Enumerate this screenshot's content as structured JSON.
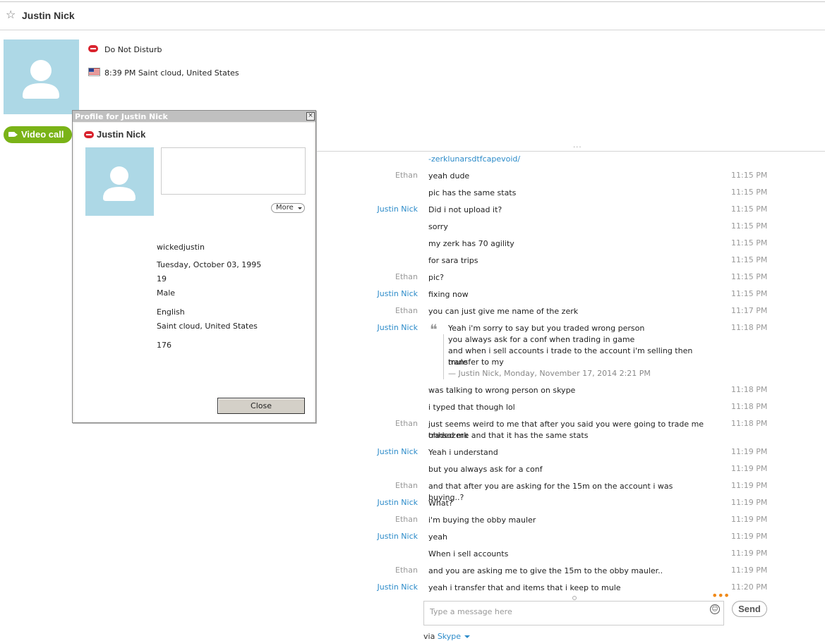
{
  "header": {
    "title": "Justin Nick",
    "favorite_icon": "star-outline-icon"
  },
  "contact": {
    "status": "Do Not Disturb",
    "local_time_location": "8:39 PM Saint cloud, United States",
    "video_call_label": "Video call"
  },
  "chat": {
    "messages": [
      {
        "sender": "",
        "text": "-zerklunarsdtfcapevoid/",
        "time": "",
        "is_link": true
      },
      {
        "sender": "Ethan",
        "text": "yeah dude",
        "time": "11:15 PM"
      },
      {
        "sender": "",
        "text": "pic has the same stats",
        "time": "11:15 PM"
      },
      {
        "sender": "Justin Nick",
        "text": "Did i not upload it?",
        "time": "11:15 PM"
      },
      {
        "sender": "",
        "text": "sorry",
        "time": "11:15 PM"
      },
      {
        "sender": "",
        "text": "my zerk has 70 agility",
        "time": "11:15 PM"
      },
      {
        "sender": "",
        "text": "for sara trips",
        "time": "11:15 PM"
      },
      {
        "sender": "Ethan",
        "text": "pic?",
        "time": "11:15 PM"
      },
      {
        "sender": "Justin Nick",
        "text": "fixing now",
        "time": "11:15 PM"
      },
      {
        "sender": "Ethan",
        "text": "you can just give me name of the zerk",
        "time": "11:17 PM"
      }
    ],
    "quote": {
      "sender": "Justin Nick",
      "time": "11:18 PM",
      "lines": [
        "Yeah i'm sorry to say but you traded wrong person",
        "you always ask for a conf when trading in game",
        "and when i sell accounts i trade to the account i'm selling then transfer to my",
        "mule"
      ],
      "attribution": "— Justin Nick, Monday, November 17, 2014 2:21 PM"
    },
    "messages_after": [
      {
        "sender": "",
        "text": "was talking to wrong person on skype",
        "time": "11:18 PM"
      },
      {
        "sender": "",
        "text": "i typed that though lol",
        "time": "11:18 PM"
      },
      {
        "sender": "Ethan",
        "text": "just seems weird to me that after you said you were going to trade me ohhsozerk",
        "text2": "traded me and that it has the same stats",
        "time": "11:18 PM"
      },
      {
        "sender": "Justin Nick",
        "text": "Yeah i understand",
        "time": "11:19 PM"
      },
      {
        "sender": "",
        "text": "but you always ask for a conf",
        "time": "11:19 PM"
      },
      {
        "sender": "Ethan",
        "text": "and that after you are asking for the 15m on the account i was buying..?",
        "time": "11:19 PM"
      },
      {
        "sender": "Justin Nick",
        "text": "What?",
        "time": "11:19 PM"
      },
      {
        "sender": "Ethan",
        "text": "i'm buying the obby mauler",
        "time": "11:19 PM"
      },
      {
        "sender": "Justin Nick",
        "text": "yeah",
        "time": "11:19 PM"
      },
      {
        "sender": "",
        "text": "When i sell accounts",
        "time": "11:19 PM"
      },
      {
        "sender": "Ethan",
        "text": "and you are asking me to give the 15m to the obby mauler..",
        "time": "11:19 PM"
      },
      {
        "sender": "Justin Nick",
        "text": "yeah i transfer that and items that i keep to mule",
        "time": "11:20 PM"
      }
    ]
  },
  "composer": {
    "placeholder": "Type a message here",
    "send_label": "Send",
    "via_label": "via",
    "via_service": "Skype"
  },
  "profile_dialog": {
    "window_title": "Profile for Justin Nick",
    "name": "Justin Nick",
    "more_label": "More",
    "username": "wickedjustin",
    "birthday": "Tuesday, October 03, 1995",
    "age": "19",
    "gender": "Male",
    "language": "English",
    "location": "Saint cloud, United States",
    "contacts_count": "176",
    "close_label": "Close",
    "close_glyph": "×"
  },
  "colors": {
    "accent_link": "#2c8bc9",
    "video_green": "#7ab317",
    "dnd_red": "#d9232e",
    "avatar_bg": "#add8e6"
  }
}
